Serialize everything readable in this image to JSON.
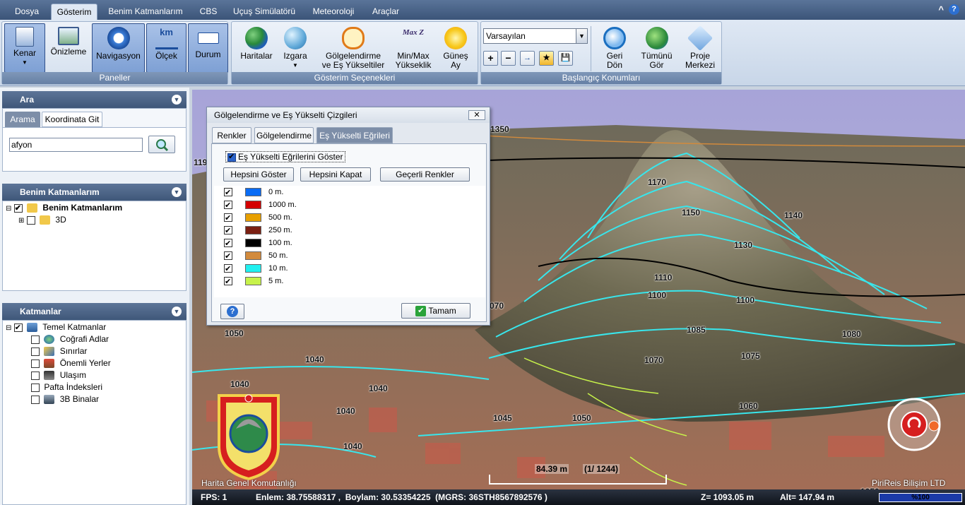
{
  "menu": {
    "tabs": [
      "Dosya",
      "Gösterim",
      "Benim Katmanlarım",
      "CBS",
      "Uçuş Simülatörü",
      "Meteoroloji",
      "Araçlar"
    ],
    "active": "Gösterim",
    "window_controls": [
      "^",
      "?"
    ]
  },
  "ribbon": {
    "paneller": {
      "label": "Paneller",
      "buttons": [
        {
          "label": "Kenar",
          "icon": "sidebar-icon"
        },
        {
          "label": "Önizleme",
          "icon": "preview-icon"
        },
        {
          "label": "Navigasyon",
          "icon": "navigation-icon"
        },
        {
          "label": "Ölçek",
          "icon": "scale-icon",
          "badge": "km"
        },
        {
          "label": "Durum",
          "icon": "status-icon"
        }
      ]
    },
    "gosterim": {
      "label": "Gösterim Seçenekleri",
      "buttons": [
        {
          "label": "Haritalar",
          "icon": "globe-icon"
        },
        {
          "label": "Izgara",
          "icon": "grid-globe-icon"
        },
        {
          "label1": "Gölgelendirme",
          "label2": "ve Eş Yükseltiler",
          "icon": "contour-icon"
        },
        {
          "label1": "Min/Max",
          "label2": "Yükseklik",
          "icon": "maxz-icon",
          "badge": "Max Z"
        },
        {
          "label1": "Güneş",
          "label2": "Ay",
          "icon": "sun-icon"
        }
      ]
    },
    "baslangic": {
      "label": "Başlangıç Konumları",
      "select_value": "Varsayılan",
      "small_buttons": [
        "+",
        "−",
        "→",
        "★",
        "💾"
      ],
      "buttons": [
        {
          "label1": "Geri",
          "label2": "Dön",
          "icon": "zoom-back-icon"
        },
        {
          "label1": "Tümünü",
          "label2": "Gör",
          "icon": "view-all-icon"
        },
        {
          "label1": "Proje",
          "label2": "Merkezi",
          "icon": "project-center-icon"
        }
      ]
    }
  },
  "left": {
    "ara": {
      "title": "Ara",
      "tabs": [
        "Arama",
        "Koordinata Git"
      ],
      "search_value": "afyon"
    },
    "benim": {
      "title": "Benim Katmanlarım",
      "items": [
        {
          "label": "Benim Katmanlarım",
          "checked": true,
          "bold": true
        },
        {
          "label": "3D",
          "checked": false
        }
      ]
    },
    "katmanlar": {
      "title": "Katmanlar",
      "items": [
        {
          "label": "Temel Katmanlar",
          "checked": true
        },
        {
          "label": "Coğrafi Adlar",
          "checked": false
        },
        {
          "label": "Sınırlar",
          "checked": false
        },
        {
          "label": "Önemli Yerler",
          "checked": false
        },
        {
          "label": "Ulaşım",
          "checked": false
        },
        {
          "label": "Pafta İndeksleri",
          "checked": false
        },
        {
          "label": "3B Binalar",
          "checked": false
        }
      ]
    }
  },
  "dialog": {
    "title": "Gölgelendirme ve Eş Yükselti Çizgileri",
    "tabs": [
      "Renkler",
      "Gölgelendirme",
      "Eş Yükselti Eğrileri"
    ],
    "show_label": "Eş Yükselti Eğrilerini Göster",
    "buttons": [
      "Hepsini Göster",
      "Hepsini Kapat",
      "Geçerli Renkler"
    ],
    "rows": [
      {
        "label": "0 m.",
        "color": "#0a6cf5"
      },
      {
        "label": "1000 m.",
        "color": "#d40000"
      },
      {
        "label": "500 m.",
        "color": "#e8a000"
      },
      {
        "label": "250 m.",
        "color": "#7a1f12"
      },
      {
        "label": "100 m.",
        "color": "#000000"
      },
      {
        "label": "50 m.",
        "color": "#d28a3c"
      },
      {
        "label": "10 m.",
        "color": "#20f0f0"
      },
      {
        "label": "5 m.",
        "color": "#c7f24a"
      }
    ],
    "ok": "Tamam",
    "help": "?"
  },
  "map": {
    "contour_labels": [
      "1350",
      "119",
      "1170",
      "1150",
      "1140",
      "1130",
      "1110",
      "1100",
      "1100",
      "070",
      "1085",
      "1080",
      "1075",
      "1070",
      "1050",
      "1040",
      "1040",
      "1040",
      "1040",
      "1060",
      "1045",
      "1050",
      "1040",
      "1050"
    ],
    "scale_text": "84.39 m",
    "scale_ratio": "(1/ 1244)",
    "watermark_left": "Harita Genel Komutanlığı",
    "watermark_right": "PiriReis Bilişim LTD"
  },
  "status": {
    "fps": "FPS: 1",
    "coords": "Enlem: 38.75588317 ,  Boylam: 30.53354225  (MGRS: 36STH8567892576 )",
    "z": "Z= 1093.05 m",
    "alt": "Alt= 147.94 m",
    "zoom": "%100"
  }
}
